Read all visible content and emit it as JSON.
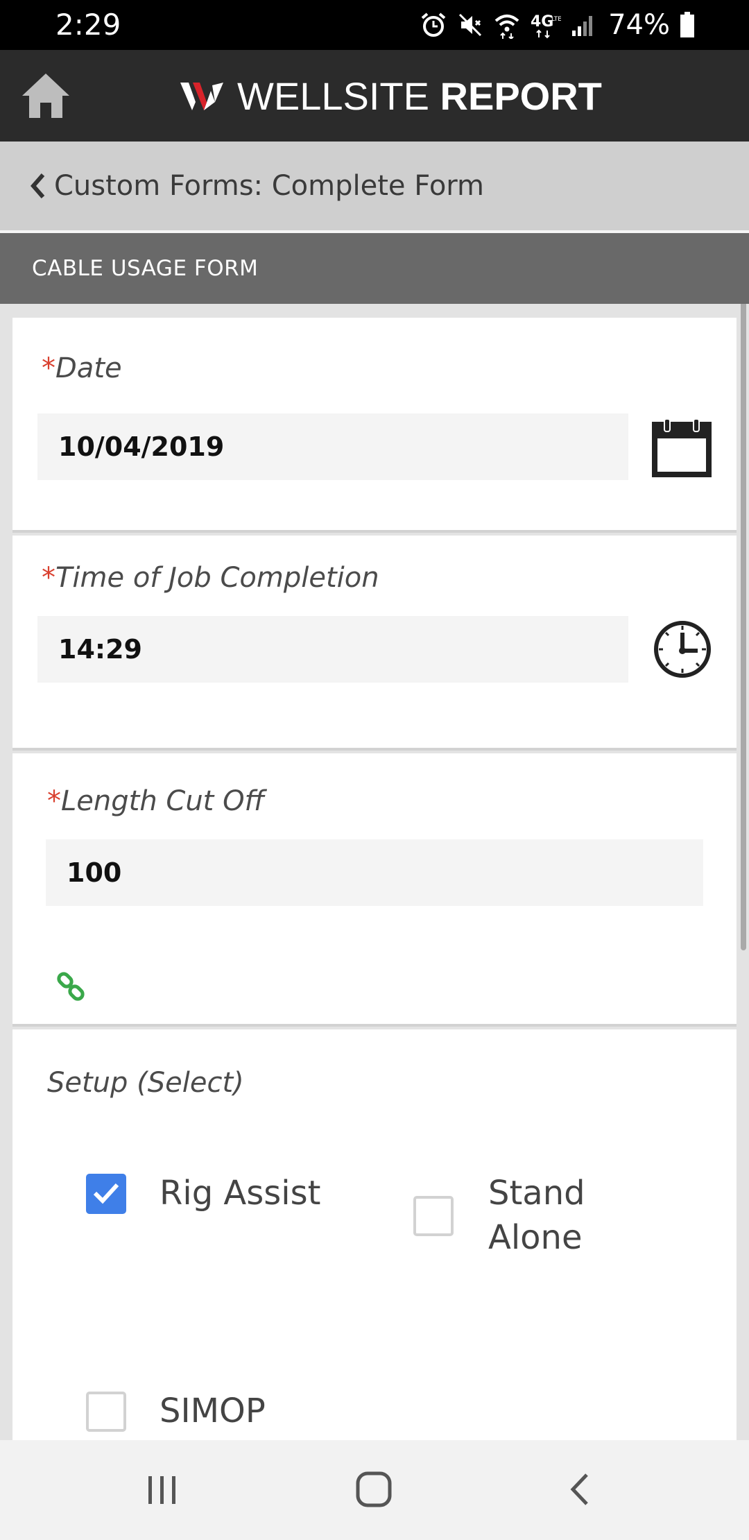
{
  "status_bar": {
    "time": "2:29",
    "battery": "74%",
    "network": "4G"
  },
  "header": {
    "brand_light": "WELLSITE",
    "brand_bold": "REPORT",
    "brand_colors": {
      "logo_red": "#d8232a",
      "logo_white": "#ffffff"
    }
  },
  "breadcrumb": {
    "text": "Custom Forms: Complete Form"
  },
  "form": {
    "title": "CABLE USAGE FORM",
    "fields": {
      "date": {
        "required_mark": "*",
        "label": "Date",
        "value": "10/04/2019"
      },
      "time": {
        "required_mark": "*",
        "label": "Time of Job Completion",
        "value": "14:29"
      },
      "length": {
        "required_mark": "*",
        "label": "Length Cut Off",
        "value": "100"
      }
    },
    "setup": {
      "label": "Setup (Select)",
      "options": [
        {
          "label": "Rig Assist",
          "checked": true
        },
        {
          "label_line1": "Stand",
          "label_line2": "Alone",
          "checked": false
        },
        {
          "label": "SIMOP",
          "checked": false
        }
      ]
    }
  },
  "icons": {
    "home": "home-icon",
    "back": "chevron-left-icon",
    "calendar": "calendar-icon",
    "clock": "clock-icon",
    "link": "link-icon",
    "nav_recents": "recents-icon",
    "nav_home": "home-circle-icon",
    "nav_back": "back-icon"
  },
  "colors": {
    "accent_blue": "#3f7fe8",
    "required_red": "#d9402f",
    "link_green": "#3aa84a",
    "header_bg": "#2b2b2b"
  }
}
